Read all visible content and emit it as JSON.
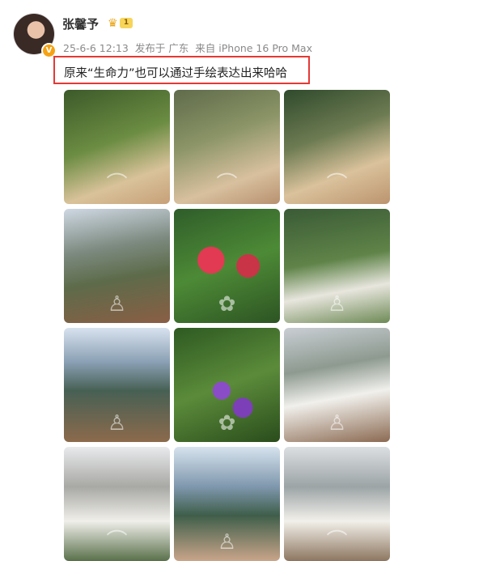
{
  "post": {
    "user": {
      "name": "张馨予",
      "verified_mark": "V",
      "level_badge": "1"
    },
    "meta": {
      "date": "25-6-6 12:13",
      "location": "发布于 广东",
      "source": "来自 iPhone 16 Pro Max"
    },
    "caption": "原来“生命力”也可以通过手绘表达出来哈哈"
  },
  "photos": [
    {
      "icon": "sun-hat-icon"
    },
    {
      "icon": "sun-hat-icon"
    },
    {
      "icon": "sun-hat-icon"
    },
    {
      "icon": "person-icon"
    },
    {
      "icon": "flower-icon"
    },
    {
      "icon": "person-icon"
    },
    {
      "icon": "person-icon"
    },
    {
      "icon": "flower-icon"
    },
    {
      "icon": "person-icon"
    },
    {
      "icon": "sun-hat-icon"
    },
    {
      "icon": "person-icon"
    },
    {
      "icon": "sun-hat-icon"
    }
  ],
  "colors": {
    "highlight_border": "#e53935",
    "meta_text": "#8a8a8a",
    "crown": "#e8a317"
  }
}
